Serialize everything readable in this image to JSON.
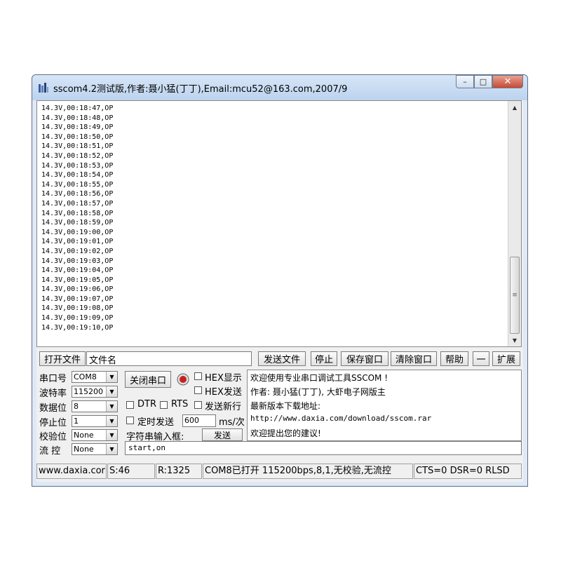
{
  "window": {
    "title": "sscom4.2测试版,作者:聂小猛(丁丁),Email:mcu52@163.com,2007/9",
    "buttons": {
      "minimize": "–",
      "maximize": "□",
      "close": "✕"
    }
  },
  "output": {
    "lines": [
      "14.3V,00:18:47,OP",
      "14.3V,00:18:48,OP",
      "14.3V,00:18:49,OP",
      "14.3V,00:18:50,OP",
      "14.3V,00:18:51,OP",
      "14.3V,00:18:52,OP",
      "14.3V,00:18:53,OP",
      "14.3V,00:18:54,OP",
      "14.3V,00:18:55,OP",
      "14.3V,00:18:56,OP",
      "14.3V,00:18:57,OP",
      "14.3V,00:18:58,OP",
      "14.3V,00:18:59,OP",
      "14.3V,00:19:00,OP",
      "14.3V,00:19:01,OP",
      "14.3V,00:19:02,OP",
      "14.3V,00:19:03,OP",
      "14.3V,00:19:04,OP",
      "14.3V,00:19:05,OP",
      "14.3V,00:19:06,OP",
      "14.3V,00:19:07,OP",
      "14.3V,00:19:08,OP",
      "14.3V,00:19:09,OP",
      "14.3V,00:19:10,OP"
    ],
    "scroll_up": "▲",
    "scroll_down": "▼",
    "thumb_grip": "≡"
  },
  "toolbar": {
    "open_file": "打开文件",
    "filename": "文件名",
    "send_file": "发送文件",
    "stop": "停止",
    "save_window": "保存窗口",
    "clear_window": "清除窗口",
    "help": "帮助",
    "dash": "一",
    "expand": "扩展"
  },
  "settings": {
    "port_label": "串口号",
    "port_value": "COM8",
    "baud_label": "波特率",
    "baud_value": "115200",
    "databits_label": "数据位",
    "databits_value": "8",
    "stopbits_label": "停止位",
    "stopbits_value": "1",
    "parity_label": "校验位",
    "parity_value": "None",
    "flow_label": "流 控",
    "flow_value": "None",
    "close_port": "关闭串口",
    "hex_display": "HEX显示",
    "hex_send": "HEX发送",
    "dtr": "DTR",
    "rts": "RTS",
    "send_newline": "发送新行",
    "timed_send": "定时发送",
    "interval_value": "600",
    "interval_unit": "ms/次",
    "input_label": "字符串输入框:",
    "send_button": "发送",
    "input_value": "start,on",
    "arrow": "▼"
  },
  "messages": [
    "欢迎使用专业串口调试工具SSCOM !",
    "作者: 聂小猛(丁丁), 大虾电子网版主",
    "最新版本下载地址:",
    "http://www.daxia.com/download/sscom.rar",
    "欢迎提出您的建议!"
  ],
  "status": {
    "site": "www.daxia.cor",
    "sent": "S:46",
    "received": "R:1325",
    "port_state": "COM8已打开  115200bps,8,1,无校验,无流控",
    "signals": "CTS=0 DSR=0 RLSD"
  },
  "colors": {
    "indicator": "#c62020",
    "titlebar": "#c5d9f1",
    "close": "#c64a33"
  }
}
